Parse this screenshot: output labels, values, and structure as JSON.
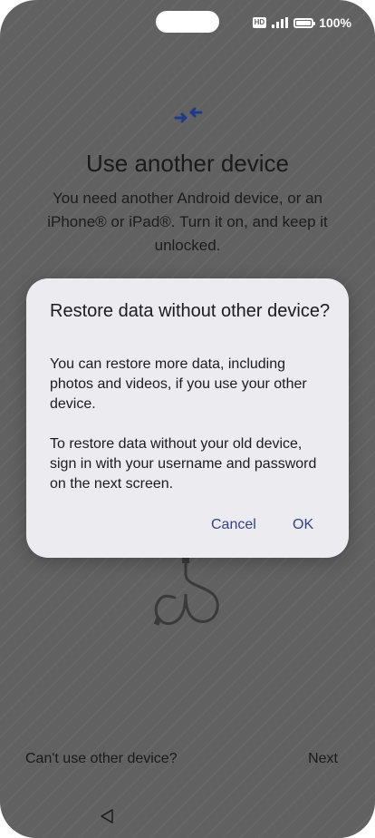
{
  "status_bar": {
    "hd_label": "HD",
    "battery_text": "100%"
  },
  "main": {
    "title": "Use another device",
    "description": "You need another Android device, or an iPhone® or iPad®. Turn it on, and keep it unlocked."
  },
  "footer": {
    "left_link": "Can't use other device?",
    "right_link": "Next"
  },
  "dialog": {
    "title": "Restore data without other device?",
    "body_paragraphs": [
      "You can restore more data, including photos and videos, if you use your other device.",
      "To restore data without your old device, sign in with your username and password on the next screen."
    ],
    "cancel_label": "Cancel",
    "ok_label": "OK"
  },
  "colors": {
    "scrim_background": "#616161",
    "dialog_background": "#ebebf0",
    "accent": "#35428b",
    "transfer_icon": "#1e3a8a"
  }
}
